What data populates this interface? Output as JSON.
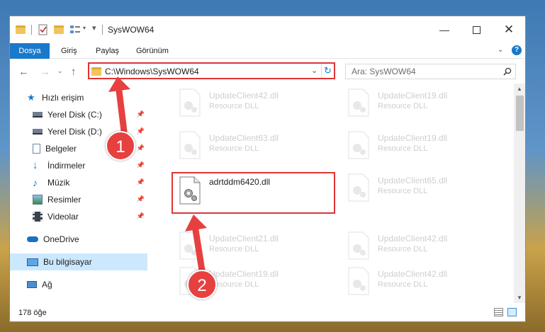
{
  "window": {
    "title": "SysWOW64"
  },
  "ribbon": {
    "tabs": [
      "Dosya",
      "Giriş",
      "Paylaş",
      "Görünüm"
    ]
  },
  "address": {
    "path": "C:\\Windows\\SysWOW64"
  },
  "search": {
    "placeholder": "Ara: SysWOW64"
  },
  "sidebar": {
    "items": [
      {
        "label": "Hızlı erişim",
        "icon": "star-icon"
      },
      {
        "label": "Yerel Disk (C:)",
        "icon": "drive-icon"
      },
      {
        "label": "Yerel Disk (D:)",
        "icon": "drive-icon"
      },
      {
        "label": "Belgeler",
        "icon": "documents-icon"
      },
      {
        "label": "İndirmeler",
        "icon": "download-icon"
      },
      {
        "label": "Müzik",
        "icon": "music-icon"
      },
      {
        "label": "Resimler",
        "icon": "pictures-icon"
      },
      {
        "label": "Videolar",
        "icon": "videos-icon"
      },
      {
        "label": "OneDrive",
        "icon": "cloud-icon"
      },
      {
        "label": "Bu bilgisayar",
        "icon": "computer-icon"
      },
      {
        "label": "Ağ",
        "icon": "network-icon"
      }
    ]
  },
  "files": {
    "left": [
      {
        "name": "UpdateClient42.dll",
        "type": "Resource DLL"
      },
      {
        "name": "UpdateClient63.dll",
        "type": "Resource DLL"
      },
      {
        "name": "adrtddm6420.dll",
        "type": ""
      },
      {
        "name": "UpdateClient21.dll",
        "type": "Resource DLL"
      },
      {
        "name": "UpdateClient19.dll",
        "type": "Resource DLL"
      }
    ],
    "right": [
      {
        "name": "UpdateClient19.dll",
        "type": "Resource DLL"
      },
      {
        "name": "UpdateClient19.dll",
        "type": "Resource DLL"
      },
      {
        "name": "UpdateClient65.dll",
        "type": "Resource DLL"
      },
      {
        "name": "UpdateClient42.dll",
        "type": "Resource DLL"
      },
      {
        "name": "UpdateClient42.dll",
        "type": "Resource DLL"
      }
    ]
  },
  "status": {
    "count": "178 öğe"
  },
  "annotations": {
    "step1": "1",
    "step2": "2"
  },
  "colors": {
    "accent": "#1979ca",
    "highlight": "#e03434",
    "selected": "#cce8ff"
  }
}
